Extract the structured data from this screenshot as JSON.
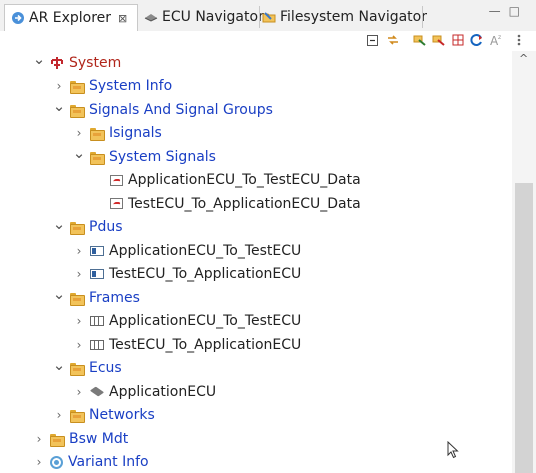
{
  "tabs": [
    {
      "label": "AR Explorer",
      "close": "⊠",
      "active": true,
      "icon": "arrow-circle-icon"
    },
    {
      "label": "ECU Navigator",
      "active": false,
      "icon": "ecu-diamond-icon"
    },
    {
      "label": "Filesystem Navigator",
      "active": false,
      "icon": "filesystem-icon"
    }
  ],
  "window_controls": {
    "minimize": "—",
    "maximize": "□"
  },
  "toolbar": {
    "icons": [
      "collapse-all-icon",
      "link-editor-icon",
      "filter-icon-1",
      "filter-icon-2",
      "grid-icon",
      "refresh-icon",
      "font-icon",
      "view-menu-icon"
    ]
  },
  "tree": [
    {
      "label": "System",
      "level": 0,
      "expanded": true,
      "icon": "system-icon",
      "color": "red"
    },
    {
      "label": "System Info",
      "level": 1,
      "expanded": false,
      "icon": "folder-icon",
      "color": "blue"
    },
    {
      "label": "Signals And Signal Groups",
      "level": 1,
      "expanded": true,
      "icon": "folder-icon",
      "color": "blue"
    },
    {
      "label": "Isignals",
      "level": 2,
      "expanded": false,
      "icon": "folder-icon",
      "color": "blue"
    },
    {
      "label": "System Signals",
      "level": 2,
      "expanded": true,
      "icon": "folder-icon",
      "color": "blue"
    },
    {
      "label": "ApplicationECU_To_TestECU_Data",
      "level": 3,
      "leaf": true,
      "icon": "signal-icon",
      "color": "dark"
    },
    {
      "label": "TestECU_To_ApplicationECU_Data",
      "level": 3,
      "leaf": true,
      "icon": "signal-icon",
      "color": "dark"
    },
    {
      "label": "Pdus",
      "level": 1,
      "expanded": true,
      "icon": "folder-icon",
      "color": "blue"
    },
    {
      "label": "ApplicationECU_To_TestECU",
      "level": 2,
      "expanded": false,
      "icon": "pdu-icon",
      "color": "dark"
    },
    {
      "label": "TestECU_To_ApplicationECU",
      "level": 2,
      "expanded": false,
      "icon": "pdu-icon",
      "color": "dark"
    },
    {
      "label": "Frames",
      "level": 1,
      "expanded": true,
      "icon": "folder-icon",
      "color": "blue"
    },
    {
      "label": "ApplicationECU_To_TestECU",
      "level": 2,
      "expanded": false,
      "icon": "frame-icon",
      "color": "dark"
    },
    {
      "label": "TestECU_To_ApplicationECU",
      "level": 2,
      "expanded": false,
      "icon": "frame-icon",
      "color": "dark"
    },
    {
      "label": "Ecus",
      "level": 1,
      "expanded": true,
      "icon": "folder-icon",
      "color": "blue"
    },
    {
      "label": "ApplicationECU",
      "level": 2,
      "expanded": false,
      "icon": "ecu-icon",
      "color": "dark"
    },
    {
      "label": "Networks",
      "level": 1,
      "expanded": false,
      "icon": "folder-icon",
      "color": "blue"
    },
    {
      "label": "Bsw Mdt",
      "level": 0,
      "expanded": false,
      "icon": "folder-icon",
      "color": "blue"
    },
    {
      "label": "Variant Info",
      "level": 0,
      "expanded": false,
      "icon": "variant-icon",
      "color": "blue"
    }
  ],
  "colors": {
    "label_blue": "#1a3fc4",
    "label_red": "#b1261b",
    "folder": "#f2c35a"
  }
}
